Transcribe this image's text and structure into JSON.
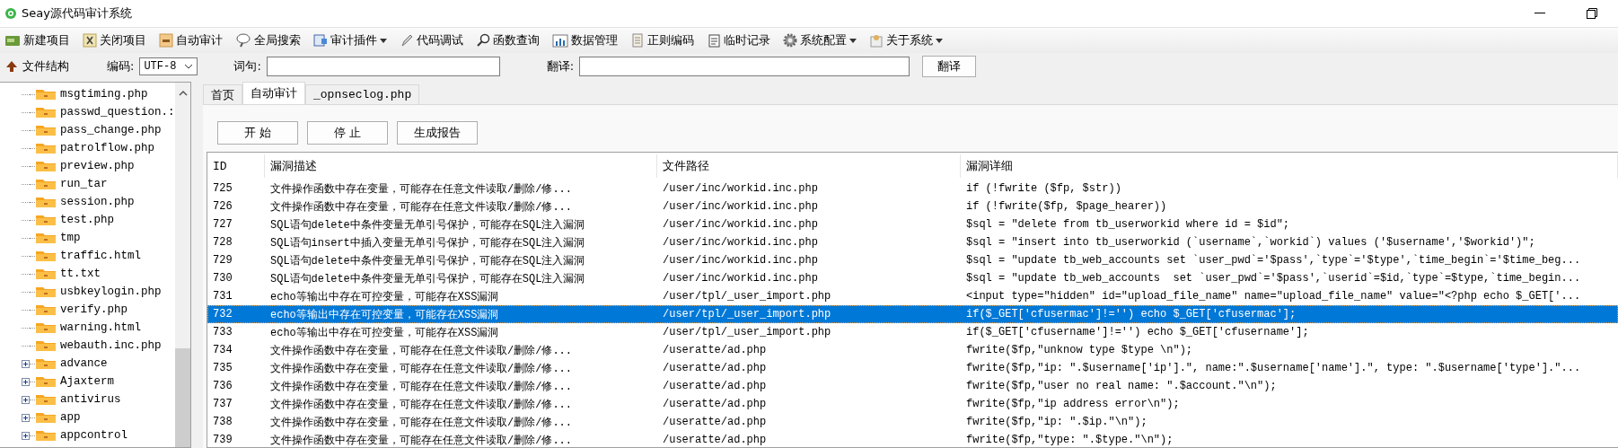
{
  "window": {
    "title": "Seay源代码审计系统"
  },
  "toolbar": [
    {
      "label": "新建项目",
      "dropdown": false
    },
    {
      "label": "关闭项目",
      "dropdown": false
    },
    {
      "label": "自动审计",
      "dropdown": false
    },
    {
      "label": "全局搜索",
      "dropdown": false
    },
    {
      "label": "审计插件",
      "dropdown": true
    },
    {
      "label": "代码调试",
      "dropdown": false
    },
    {
      "label": "函数查询",
      "dropdown": false
    },
    {
      "label": "数据管理",
      "dropdown": false
    },
    {
      "label": "正则编码",
      "dropdown": false
    },
    {
      "label": "临时记录",
      "dropdown": false
    },
    {
      "label": "系统配置",
      "dropdown": true
    },
    {
      "label": "关于系统",
      "dropdown": true
    }
  ],
  "searchbar": {
    "structure_label": "文件结构",
    "encoding_label": "编码:",
    "encoding_value": "UTF-8",
    "phrase_label": "词句:",
    "translate_label": "翻译:",
    "translate_button": "翻译"
  },
  "tree": [
    {
      "label": "msgtiming.php",
      "kind": "file"
    },
    {
      "label": "passwd_question.:",
      "kind": "file"
    },
    {
      "label": "pass_change.php",
      "kind": "file"
    },
    {
      "label": "patrolflow.php",
      "kind": "file"
    },
    {
      "label": "preview.php",
      "kind": "file"
    },
    {
      "label": "run_tar",
      "kind": "file"
    },
    {
      "label": "session.php",
      "kind": "file"
    },
    {
      "label": "test.php",
      "kind": "file"
    },
    {
      "label": "tmp",
      "kind": "file"
    },
    {
      "label": "traffic.html",
      "kind": "file"
    },
    {
      "label": "tt.txt",
      "kind": "file"
    },
    {
      "label": "usbkeylogin.php",
      "kind": "file"
    },
    {
      "label": "verify.php",
      "kind": "file"
    },
    {
      "label": "warning.html",
      "kind": "file"
    },
    {
      "label": "webauth.inc.php",
      "kind": "file"
    },
    {
      "label": "advance",
      "kind": "folder",
      "expanded": false
    },
    {
      "label": "Ajaxterm",
      "kind": "folder",
      "expanded": false
    },
    {
      "label": "antivirus",
      "kind": "folder",
      "expanded": false
    },
    {
      "label": "app",
      "kind": "folder",
      "expanded": false
    },
    {
      "label": "appcontrol",
      "kind": "folder",
      "expanded": false
    }
  ],
  "tabs": [
    {
      "label": "首页",
      "selected": false
    },
    {
      "label": "自动审计",
      "selected": true
    },
    {
      "label": "_opnseclog.php",
      "selected": false
    }
  ],
  "buttons": [
    "开 始",
    "停 止",
    "生成报告"
  ],
  "table": {
    "columns": [
      "ID",
      "漏洞描述",
      "文件路径",
      "漏洞详细"
    ],
    "rows": [
      {
        "id": "725",
        "description": "文件操作函数中存在变量，可能存在任意文件读取/删除/修...",
        "path": "/user/inc/workid.inc.php",
        "detail": "if (!fwrite ($fp, $str))",
        "selected": false
      },
      {
        "id": "726",
        "description": "文件操作函数中存在变量，可能存在任意文件读取/删除/修...",
        "path": "/user/inc/workid.inc.php",
        "detail": "if (!fwrite($fp, $page_hearer))",
        "selected": false
      },
      {
        "id": "727",
        "description": "SQL语句delete中条件变量无单引号保护，可能存在SQL注入漏洞",
        "path": "/user/inc/workid.inc.php",
        "detail": "$sql = \"delete from tb_userworkid where id = $id\";",
        "selected": false
      },
      {
        "id": "728",
        "description": "SQL语句insert中插入变量无单引号保护，可能存在SQL注入漏洞",
        "path": "/user/inc/workid.inc.php",
        "detail": "$sql = \"insert into tb_userworkid (`username`,`workid`) values ('$username','$workid')\";",
        "selected": false
      },
      {
        "id": "729",
        "description": "SQL语句delete中条件变量无单引号保护，可能存在SQL注入漏洞",
        "path": "/user/inc/workid.inc.php",
        "detail": "$sql = \"update tb_web_accounts set `user_pwd`='$pass',`type`='$type',`time_begin`='$time_beg...",
        "selected": false
      },
      {
        "id": "730",
        "description": "SQL语句delete中条件变量无单引号保护，可能存在SQL注入漏洞",
        "path": "/user/inc/workid.inc.php",
        "detail": "$sql = \"update tb_web_accounts  set `user_pwd`='$pass',`userid`=$id,`type`=$type,`time_begin...",
        "selected": false
      },
      {
        "id": "731",
        "description": "echo等输出中存在可控变量，可能存在XSS漏洞",
        "path": "/user/tpl/_user_import.php",
        "detail": "<input type=\"hidden\" id=\"upload_file_name\" name=\"upload_file_name\" value=\"<?php echo $_GET['...",
        "selected": false
      },
      {
        "id": "732",
        "description": "echo等输出中存在可控变量，可能存在XSS漏洞",
        "path": "/user/tpl/_user_import.php",
        "detail": "if($_GET['cfusermac']!='') echo $_GET['cfusermac'];",
        "selected": true
      },
      {
        "id": "733",
        "description": "echo等输出中存在可控变量，可能存在XSS漏洞",
        "path": "/user/tpl/_user_import.php",
        "detail": "if($_GET['cfusername']!='') echo $_GET['cfusername'];",
        "selected": false
      },
      {
        "id": "734",
        "description": "文件操作函数中存在变量，可能存在任意文件读取/删除/修...",
        "path": "/useratte/ad.php",
        "detail": "fwrite($fp,\"unknow type $type \\n\");",
        "selected": false
      },
      {
        "id": "735",
        "description": "文件操作函数中存在变量，可能存在任意文件读取/删除/修...",
        "path": "/useratte/ad.php",
        "detail": "fwrite($fp,\"ip: \".$username['ip'].\", name:\".$username['name'].\", type: \".$username['type'].\"...",
        "selected": false
      },
      {
        "id": "736",
        "description": "文件操作函数中存在变量，可能存在任意文件读取/删除/修...",
        "path": "/useratte/ad.php",
        "detail": "fwrite($fp,\"user no real name: \".$account.\"\\n\");",
        "selected": false
      },
      {
        "id": "737",
        "description": "文件操作函数中存在变量，可能存在任意文件读取/删除/修...",
        "path": "/useratte/ad.php",
        "detail": "fwrite($fp,\"ip address error\\n\");",
        "selected": false
      },
      {
        "id": "738",
        "description": "文件操作函数中存在变量，可能存在任意文件读取/删除/修...",
        "path": "/useratte/ad.php",
        "detail": "fwrite($fp,\"ip: \".$ip.\"\\n\");",
        "selected": false
      },
      {
        "id": "739",
        "description": "文件操作函数中存在变量，可能存在任意文件读取/删除/修...",
        "path": "/useratte/ad.php",
        "detail": "fwrite($fp,\"type: \".$type.\"\\n\");",
        "selected": false
      }
    ]
  }
}
